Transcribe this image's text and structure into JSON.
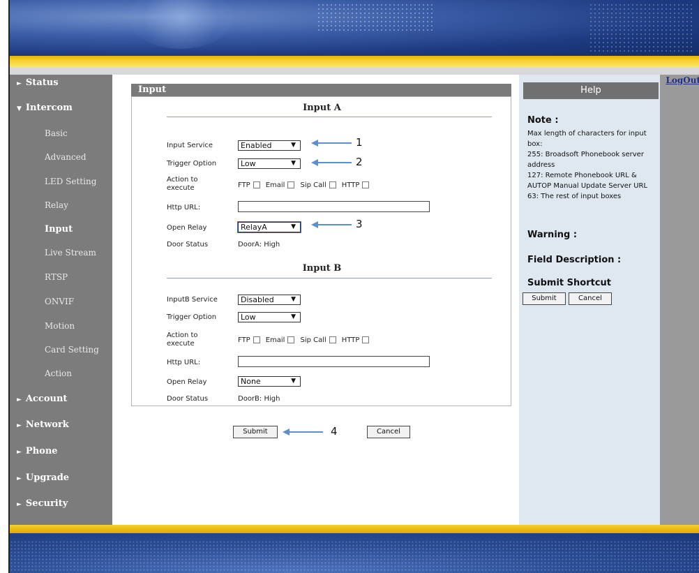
{
  "header": {
    "logout_label": "LogOut"
  },
  "sidebar": {
    "items": [
      {
        "label": "Status",
        "level": "top"
      },
      {
        "label": "Intercom",
        "level": "top",
        "expanded": true
      },
      {
        "label": "Basic",
        "level": "sub"
      },
      {
        "label": "Advanced",
        "level": "sub"
      },
      {
        "label": "LED Setting",
        "level": "sub"
      },
      {
        "label": "Relay",
        "level": "sub"
      },
      {
        "label": "Input",
        "level": "sub",
        "active": true
      },
      {
        "label": "Live Stream",
        "level": "sub"
      },
      {
        "label": "RTSP",
        "level": "sub"
      },
      {
        "label": "ONVIF",
        "level": "sub"
      },
      {
        "label": "Motion",
        "level": "sub"
      },
      {
        "label": "Card Setting",
        "level": "sub"
      },
      {
        "label": "Action",
        "level": "sub"
      },
      {
        "label": "Account",
        "level": "top"
      },
      {
        "label": "Network",
        "level": "top"
      },
      {
        "label": "Phone",
        "level": "top"
      },
      {
        "label": "Upgrade",
        "level": "top"
      },
      {
        "label": "Security",
        "level": "top"
      }
    ]
  },
  "main": {
    "title": "Input",
    "input_a": {
      "heading": "Input A",
      "service_label": "Input Service",
      "service_value": "Enabled",
      "trigger_label": "Trigger Option",
      "trigger_value": "Low",
      "action_label": "Action to execute",
      "actions": [
        "FTP",
        "Email",
        "Sip Call",
        "HTTP"
      ],
      "http_label": "Http URL:",
      "http_value": "",
      "relay_label": "Open Relay",
      "relay_value": "RelayA",
      "door_label": "Door Status",
      "door_value": "DoorA: High"
    },
    "input_b": {
      "heading": "Input B",
      "service_label": "InputB Service",
      "service_value": "Disabled",
      "trigger_label": "Trigger Option",
      "trigger_value": "Low",
      "action_label": "Action to execute",
      "actions": [
        "FTP",
        "Email",
        "Sip Call",
        "HTTP"
      ],
      "http_label": "Http URL:",
      "http_value": "",
      "relay_label": "Open Relay",
      "relay_value": "None",
      "door_label": "Door Status",
      "door_value": "DoorB: High"
    },
    "submit_label": "Submit",
    "cancel_label": "Cancel"
  },
  "annotations": {
    "labels": [
      "1",
      "2",
      "3",
      "4"
    ],
    "arrow_color": "#5b8fd0"
  },
  "help": {
    "title": "Help",
    "note_heading": "Note :",
    "note_lines": [
      "Max length of characters for input",
      "box:",
      "255: Broadsoft Phonebook server",
      "address",
      "127: Remote Phonebook URL &",
      "AUTOP Manual Update Server URL",
      "63: The rest of input boxes"
    ],
    "warning_heading": "Warning :",
    "field_heading": "Field Description :",
    "shortcut_heading": "Submit Shortcut",
    "submit_label": "Submit",
    "cancel_label": "Cancel"
  },
  "colors": {
    "banner": "#1d3a80",
    "gold": "#f5d130",
    "sidebar": "#7c7c7c",
    "title_bar": "#7a7a7a",
    "help_bg": "#dfe8f1"
  }
}
